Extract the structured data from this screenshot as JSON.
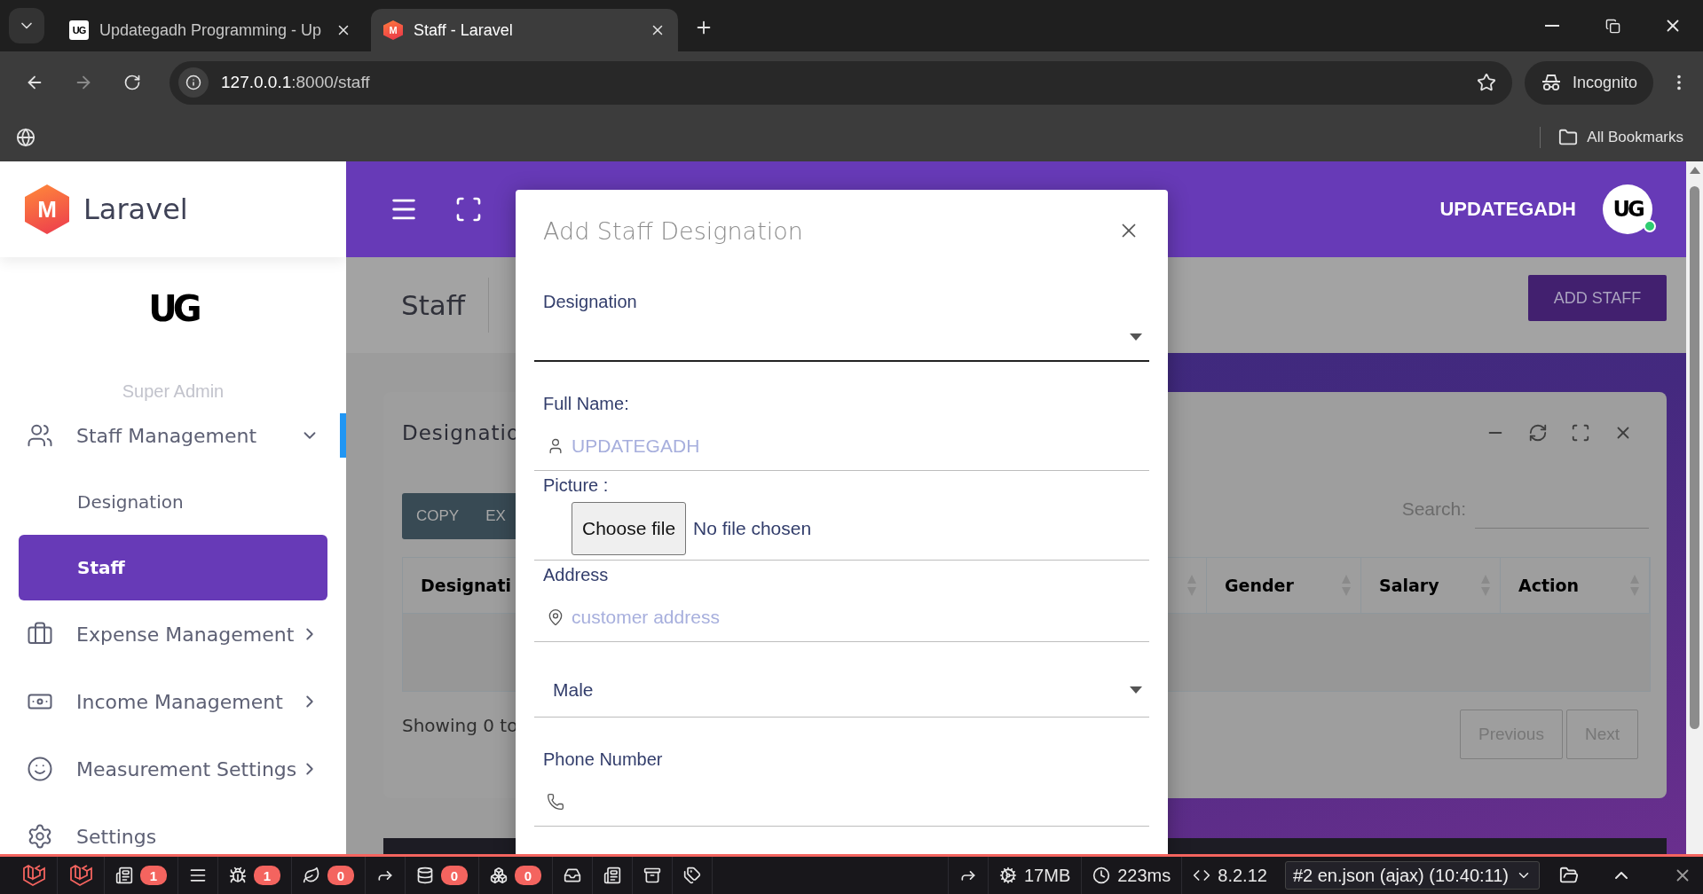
{
  "browser": {
    "tabs": [
      {
        "title": "Updategadh Programming - Up",
        "favicon_text": "UG",
        "selected": false
      },
      {
        "title": "Staff - Laravel",
        "favicon_text": "M",
        "selected": true
      }
    ],
    "url_host": "127.0.0.1",
    "url_path": ":8000/staff",
    "profile": "Incognito",
    "bookmarks": "All Bookmarks"
  },
  "sidebar": {
    "brand_mark": "M",
    "brand": "Laravel",
    "logo": "UG",
    "role": "Super Admin",
    "nav": [
      {
        "label": "Staff Management",
        "selected": true,
        "expanded": true,
        "children": [
          {
            "label": "Designation",
            "selected": false
          },
          {
            "label": "Staff",
            "selected": true
          }
        ]
      },
      {
        "label": "Expense Management",
        "selected": false,
        "expanded": false
      },
      {
        "label": "Income Management",
        "selected": false,
        "expanded": false
      },
      {
        "label": "Measurement Settings",
        "selected": false,
        "expanded": false
      },
      {
        "label": "Settings",
        "selected": false
      }
    ]
  },
  "header": {
    "user": "UPDATEGADH",
    "avatar": "UG",
    "online": true
  },
  "page": {
    "title": "Staff",
    "add_button": "ADD STAFF"
  },
  "card": {
    "title": "Designatio",
    "exports": [
      "COPY",
      "EX"
    ],
    "search_label": "Search:",
    "columns": [
      {
        "label": "Designati",
        "sortable": false
      },
      {
        "sortable": true
      },
      {
        "label": "Gender",
        "sortable": true
      },
      {
        "label": "Salary",
        "sortable": true
      },
      {
        "label": "Action",
        "sortable": true
      }
    ],
    "info": "Showing 0 to",
    "pages": [
      {
        "label": "Previous",
        "disabled": true
      },
      {
        "label": "Next",
        "disabled": true
      }
    ]
  },
  "modal": {
    "title": "Add Staff Designation",
    "fields": [
      {
        "kind": "select",
        "label": "Designation",
        "focused": true
      },
      {
        "kind": "text",
        "label": "Full Name:",
        "placeholder": "UPDATEGADH",
        "focused": false
      },
      {
        "kind": "file",
        "label": "Picture :",
        "button": "Choose file",
        "status": "No file chosen",
        "focused": false
      },
      {
        "kind": "text",
        "label": "Address",
        "placeholder": "customer address",
        "focused": false
      },
      {
        "kind": "select",
        "value": "Male",
        "focused": false
      },
      {
        "kind": "text",
        "label": "Phone Number",
        "focused": false
      }
    ]
  },
  "debug_bar": {
    "items": [
      {
        "kind": "logo"
      },
      {
        "kind": "logo"
      },
      {
        "kind": "messages",
        "badge": "1"
      },
      {
        "kind": "timeline"
      },
      {
        "kind": "exceptions",
        "badge": "1"
      },
      {
        "kind": "views",
        "badge": "0"
      },
      {
        "kind": "route"
      },
      {
        "kind": "queries",
        "badge": "0"
      },
      {
        "kind": "models",
        "badge": "0"
      },
      {
        "kind": "mails"
      },
      {
        "kind": "gate"
      },
      {
        "kind": "session"
      },
      {
        "kind": "request"
      }
    ],
    "stats": [
      {
        "kind": "route"
      },
      {
        "kind": "memory",
        "text": "17MB"
      },
      {
        "kind": "time",
        "text": "223ms"
      },
      {
        "kind": "php",
        "text": "8.2.12"
      }
    ],
    "request": "#2 en.json (ajax) (10:40:11)"
  }
}
